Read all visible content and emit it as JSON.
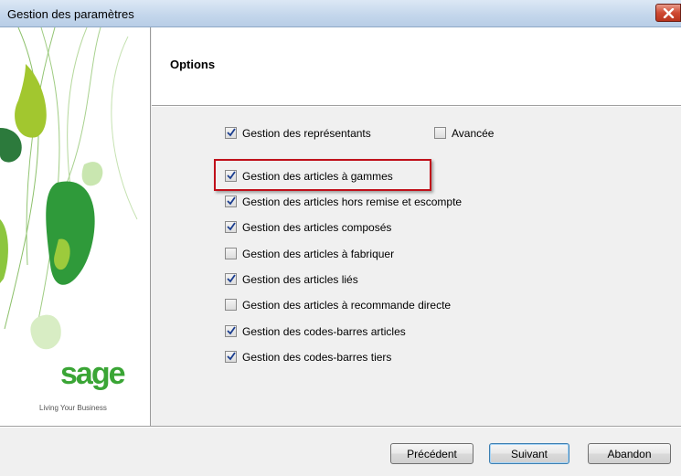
{
  "window": {
    "title": "Gestion des paramètres"
  },
  "header": {
    "title": "Options"
  },
  "brand": {
    "logo_text": "sage",
    "tagline": "Living Your Business"
  },
  "options": [
    {
      "label": "Gestion des représentants",
      "checked": true
    },
    {
      "label": "Avancée",
      "checked": false
    },
    {
      "label": "Gestion des articles à gammes",
      "checked": true,
      "highlighted": true
    },
    {
      "label": "Gestion des articles hors remise et escompte",
      "checked": true
    },
    {
      "label": "Gestion des articles composés",
      "checked": true
    },
    {
      "label": "Gestion des articles à fabriquer",
      "checked": false
    },
    {
      "label": "Gestion des articles liés",
      "checked": true
    },
    {
      "label": "Gestion des articles à recommande directe",
      "checked": false
    },
    {
      "label": "Gestion des codes-barres articles",
      "checked": true
    },
    {
      "label": "Gestion des codes-barres tiers",
      "checked": true
    }
  ],
  "buttons": {
    "previous": "Précédent",
    "next": "Suivant",
    "cancel": "Abandon"
  },
  "colors": {
    "highlight": "#c0101a",
    "brand_green": "#3aa535",
    "check": "#1a3d8f"
  }
}
